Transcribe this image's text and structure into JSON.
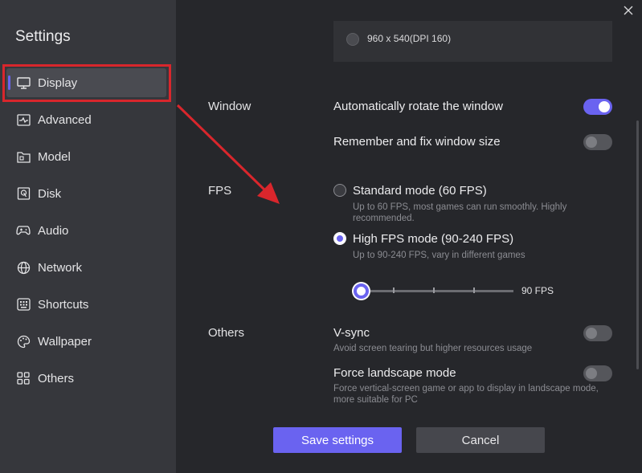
{
  "window": {
    "close_icon": "close-icon"
  },
  "sidebar": {
    "title": "Settings",
    "items": [
      {
        "label": "Display",
        "icon": "monitor-icon",
        "active": true
      },
      {
        "label": "Advanced",
        "icon": "activity-icon"
      },
      {
        "label": "Model",
        "icon": "folder-icon"
      },
      {
        "label": "Disk",
        "icon": "disk-icon"
      },
      {
        "label": "Audio",
        "icon": "gamepad-icon"
      },
      {
        "label": "Network",
        "icon": "globe-icon"
      },
      {
        "label": "Shortcuts",
        "icon": "keyboard-icon"
      },
      {
        "label": "Wallpaper",
        "icon": "palette-icon"
      },
      {
        "label": "Others",
        "icon": "grid-icon"
      }
    ]
  },
  "resolution": {
    "option_label": "960 x 540(DPI 160)"
  },
  "window_section": {
    "label": "Window",
    "auto_rotate": {
      "label": "Automatically rotate the window",
      "enabled": true
    },
    "remember_size": {
      "label": "Remember and fix window size",
      "enabled": false
    }
  },
  "fps_section": {
    "label": "FPS",
    "standard": {
      "title": "Standard mode (60 FPS)",
      "desc_line1": "Up to 60 FPS, most games can run smoothly. Highly",
      "desc_line2": "recommended.",
      "selected": false
    },
    "high": {
      "title": "High FPS mode (90-240 FPS)",
      "desc": "Up to 90-240 FPS, vary in different games",
      "selected": true
    },
    "slider": {
      "value_label": "90 FPS",
      "fraction": 0.0
    }
  },
  "others_section": {
    "label": "Others",
    "vsync": {
      "title": "V-sync",
      "desc": "Avoid screen tearing but higher resources usage",
      "enabled": false
    },
    "force_landscape": {
      "title": "Force landscape mode",
      "desc_line1": "Force vertical-screen game or app to display in landscape mode,",
      "desc_line2": "more suitable for PC",
      "enabled": false
    }
  },
  "footer": {
    "save_label": "Save settings",
    "cancel_label": "Cancel"
  },
  "colors": {
    "accent": "#6a63f0",
    "annotation_red": "#d9262c",
    "sidebar_bg": "#36373c",
    "main_bg": "#26272b"
  }
}
